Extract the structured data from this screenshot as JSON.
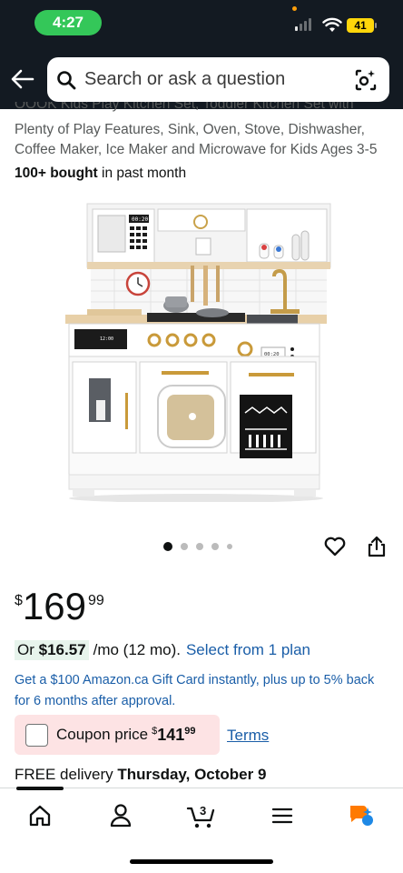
{
  "status_bar": {
    "time": "4:27",
    "battery": "41"
  },
  "search": {
    "placeholder": "Search or ask a question"
  },
  "product": {
    "title_cut": "OOOK Kids Play Kitchen Set, Toddler Kitchen Set with",
    "title_line1": "Plenty of Play Features, Sink, Oven, Stove, Dishwasher,",
    "title_line2": "Coffee Maker, Ice Maker and Microwave for Kids Ages 3-5",
    "bought_count": "100+ bought",
    "bought_suffix": " in past month",
    "microwave_display": "00:20",
    "oven_display": "00:20",
    "control_display": "12:00",
    "gallery": {
      "count": 5,
      "active_index": 0
    }
  },
  "price": {
    "symbol": "$",
    "whole": "169",
    "fraction": "99"
  },
  "installment": {
    "prefix": "Or ",
    "amount": "$16.57",
    "per": "/mo (12 mo).",
    "link": "Select from 1 plan"
  },
  "gift_card": {
    "text": "Get a $100 Amazon.ca Gift Card instantly, plus up to 5% back for 6 months after approval."
  },
  "coupon": {
    "label": "Coupon price",
    "symbol": "$",
    "whole": "141",
    "fraction": "99",
    "terms": "Terms"
  },
  "delivery": {
    "prefix": "FREE delivery ",
    "date": "Thursday, October 9"
  },
  "nav": {
    "cart_count": "3"
  },
  "colors": {
    "header_bg": "#131a22",
    "link": "#1a5ea8",
    "time_pill": "#34c759",
    "coupon_bg": "#fde3e4",
    "installment_bg": "#e7f4ec"
  }
}
